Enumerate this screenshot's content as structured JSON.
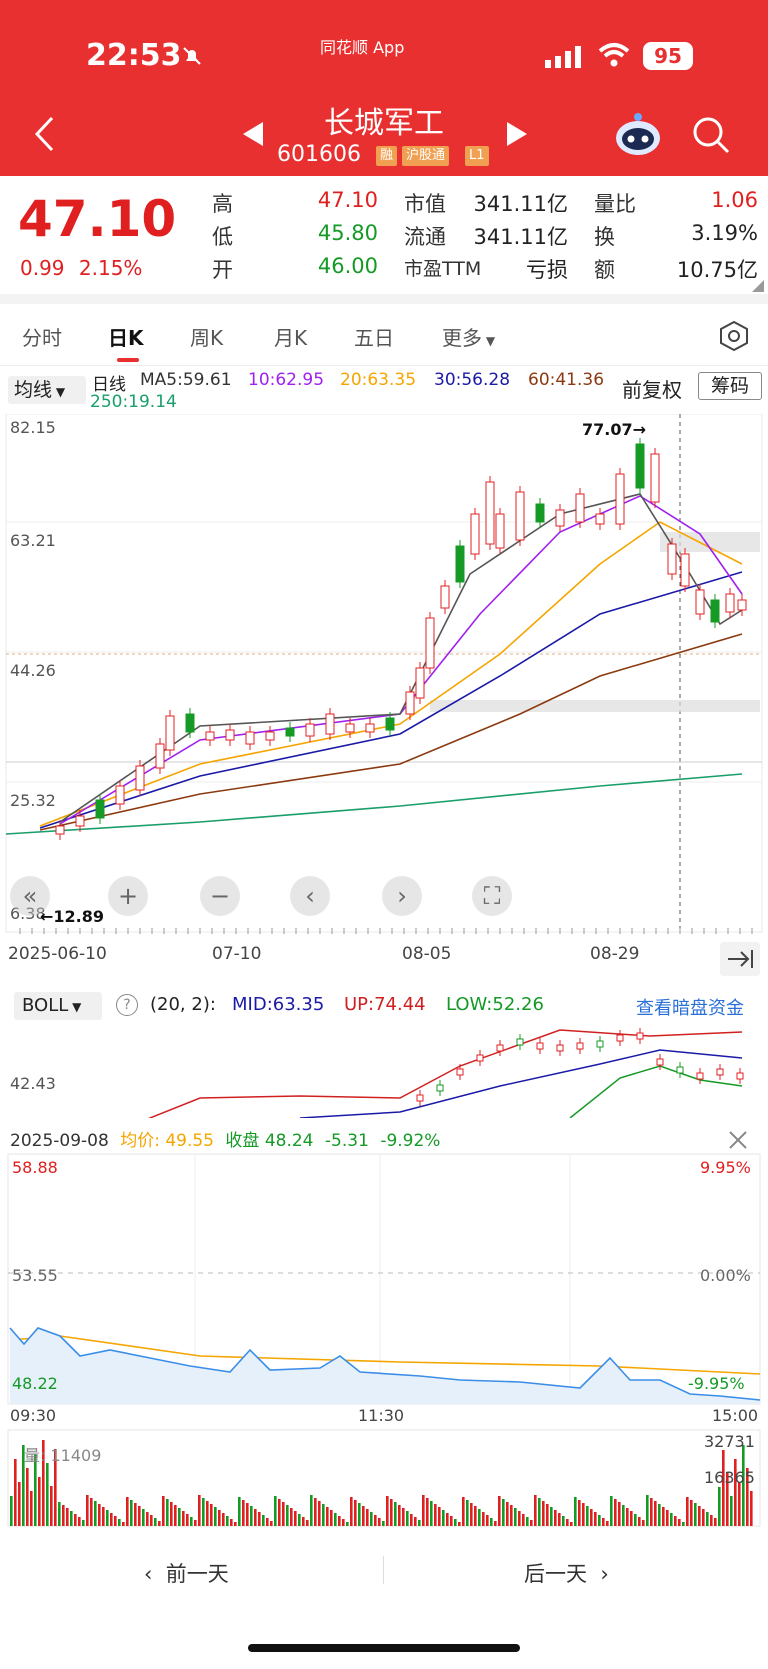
{
  "status": {
    "time": "22:53",
    "app_label": "同花顺 App",
    "battery": "95"
  },
  "stock": {
    "name": "长城军工",
    "code": "601606",
    "tags": [
      "融",
      "沪股通",
      "L1"
    ]
  },
  "quote": {
    "price": "47.10",
    "change": "0.99",
    "change_pct": "2.15%",
    "high_label": "高",
    "high": "47.10",
    "low_label": "低",
    "low": "45.80",
    "open_label": "开",
    "open": "46.00",
    "mktcap_label": "市值",
    "mktcap": "341.11亿",
    "float_label": "流通",
    "float_cap": "341.11亿",
    "pe_label": "市盈TTM",
    "pe": "亏损",
    "vol_ratio_label": "量比",
    "vol_ratio": "1.06",
    "turnover_label": "换",
    "turnover": "3.19%",
    "amount_label": "额",
    "amount": "10.75亿"
  },
  "tabs": [
    "分时",
    "日K",
    "周K",
    "月K",
    "五日",
    "更多"
  ],
  "ma_bar": {
    "select": "均线",
    "period": "日线",
    "ma5": "MA5:59.61",
    "ma10": "10:62.95",
    "ma20": "20:63.35",
    "ma30": "30:56.28",
    "ma60": "60:41.36",
    "ma250": "250:19.14",
    "adjust": "前复权",
    "chips": "筹码"
  },
  "kchart": {
    "price_ticks": [
      "82.15",
      "63.21",
      "44.26",
      "25.32",
      "6.38"
    ],
    "max_label": "77.07→",
    "min_label": "←12.89",
    "dates": [
      "2025-06-10",
      "07-10",
      "08-05",
      "08-29"
    ]
  },
  "boll": {
    "select": "BOLL",
    "params": "(20, 2):",
    "mid": "MID:63.35",
    "up": "UP:74.44",
    "low": "LOW:52.26",
    "link": "查看暗盘资金",
    "tick": "42.43"
  },
  "intraday": {
    "date": "2025-09-08",
    "avg": "均价: 49.55",
    "close": "收盘 48.24",
    "chg": "-5.31",
    "chg_pct": "-9.92%",
    "top": "58.88",
    "mid": "53.55",
    "bottom": "48.22",
    "pct_top": "9.95%",
    "pct_mid": "0.00%",
    "pct_bottom": "-9.95%",
    "t_start": "09:30",
    "t_mid": "11:30",
    "t_end": "15:00",
    "vol_label": "量: 11409",
    "vol_max": "32731",
    "vol_half": "16365"
  },
  "nav": {
    "prev": "前一天",
    "next": "后一天"
  },
  "colors": {
    "header": "#e93030",
    "up": "#e02020",
    "down": "#159a26"
  }
}
